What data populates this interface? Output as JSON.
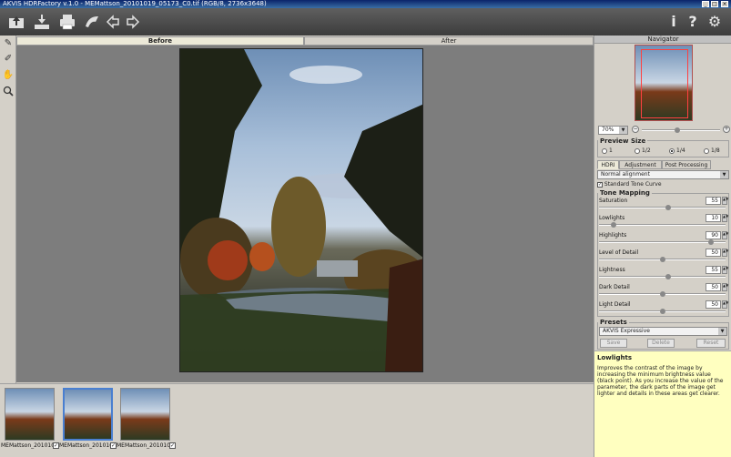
{
  "window": {
    "title": "AKVIS HDRFactory v.1.0 - MEMattson_20101019_05173_C0.tif (RGB/8, 2736x3648)"
  },
  "view_tabs": {
    "before": "Before",
    "after": "After"
  },
  "filmstrip": [
    {
      "label": "MEMattson_20101019_0...",
      "selected": false
    },
    {
      "label": "MEMattson_20101019_0...",
      "selected": true
    },
    {
      "label": "MEMattson_20101019_0...",
      "selected": false
    }
  ],
  "navigator": {
    "title": "Navigator",
    "zoom": "70%"
  },
  "preview_size": {
    "title": "Preview Size",
    "options": [
      "1",
      "1/2",
      "1/4",
      "1/8"
    ],
    "selected": 2
  },
  "panel_tabs": {
    "hdri": "HDRI",
    "adjustment": "Adjustment",
    "post": "Post Processing"
  },
  "alignment": {
    "value": "Normal alignment"
  },
  "standard_tone_curve": {
    "label": "Standard Tone Curve",
    "checked": true
  },
  "tone_mapping": {
    "title": "Tone Mapping",
    "sliders": [
      {
        "label": "Saturation",
        "value": "55",
        "fraction": 0.55
      },
      {
        "label": "Lowlights",
        "value": "10",
        "fraction": 0.1
      },
      {
        "label": "Highlights",
        "value": "90",
        "fraction": 0.9
      },
      {
        "label": "Level of Detail",
        "value": "50",
        "fraction": 0.5
      },
      {
        "label": "Lightness",
        "value": "55",
        "fraction": 0.55
      },
      {
        "label": "Dark Detail",
        "value": "50",
        "fraction": 0.5
      },
      {
        "label": "Light Detail",
        "value": "50",
        "fraction": 0.5
      }
    ]
  },
  "presets": {
    "title": "Presets",
    "value": "AKVIS Expressive",
    "save": "Save",
    "delete": "Delete",
    "reset": "Reset"
  },
  "hint": {
    "title": "Lowlights",
    "body": "Improves the contrast of the image by increasing the minimum brightness value (black point). As you increase the value of the parameter, the dark parts of the image get lighter and details in these areas get clearer."
  },
  "colors": {
    "toolbar": "#4a4a4a",
    "canvas": "#7d7d7d",
    "hint_bg": "#ffffc0",
    "panel": "#d4d0c8"
  }
}
